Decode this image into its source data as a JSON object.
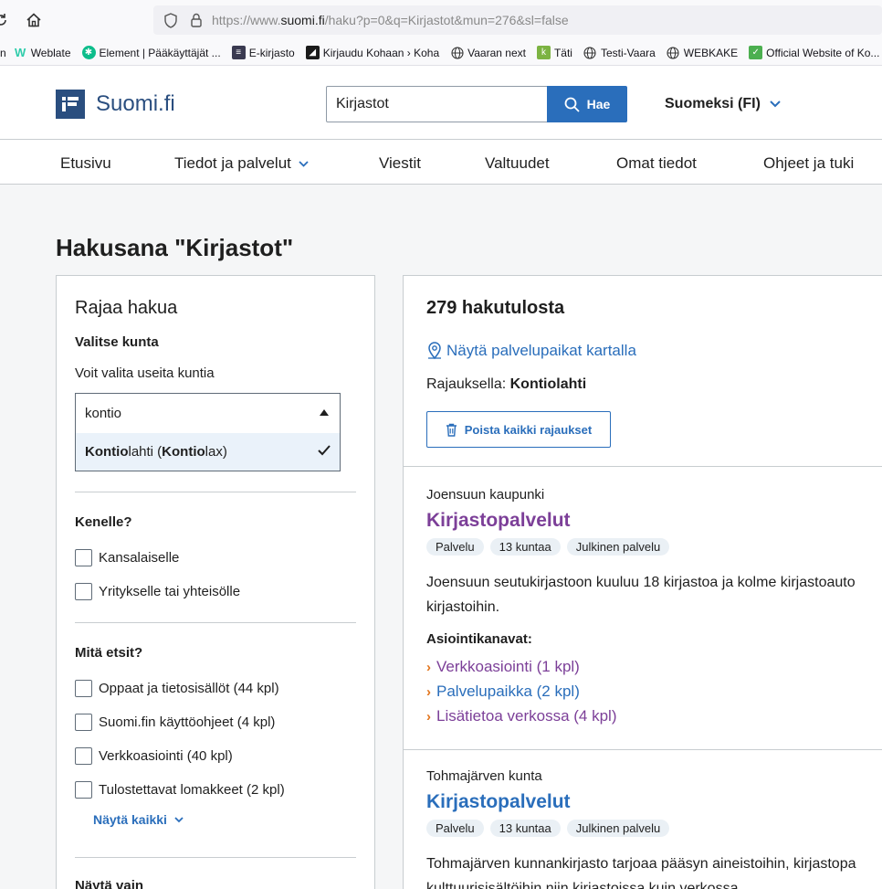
{
  "browser": {
    "url_prefix": "https://www.",
    "url_domain": "suomi.fi",
    "url_rest": "/haku?p=0&q=Kirjastot&mun=276&sl=false",
    "bookmarks": [
      {
        "label": "Weblate",
        "icon": "weblate-icon",
        "color": "#2eccaa"
      },
      {
        "label": "Element | Pääkäyttäjät ...",
        "icon": "element-icon",
        "color": "#0dbd8b"
      },
      {
        "label": "E-kirjasto",
        "icon": "ekirjasto-icon",
        "color": "#3a3a50"
      },
      {
        "label": "Kirjaudu Kohaan › Koha",
        "icon": "koha-icon",
        "color": "#1a1a1a"
      },
      {
        "label": "Vaaran next",
        "icon": "globe-icon",
        "color": ""
      },
      {
        "label": "Täti",
        "icon": "tati-icon",
        "color": "#7cb342"
      },
      {
        "label": "Testi-Vaara",
        "icon": "globe-icon",
        "color": ""
      },
      {
        "label": "WEBKAKE",
        "icon": "globe-icon",
        "color": ""
      },
      {
        "label": "Official Website of Ko...",
        "icon": "koha-leaf-icon",
        "color": "#4caf50"
      }
    ],
    "bookmark_partial": "n"
  },
  "header": {
    "logo_text": "Suomi.fi",
    "search_value": "Kirjastot",
    "search_button": "Hae",
    "language": "Suomeksi (FI)"
  },
  "nav": {
    "items": [
      "Etusivu",
      "Tiedot ja palvelut",
      "Viestit",
      "Valtuudet",
      "Omat tiedot",
      "Ohjeet ja tuki"
    ]
  },
  "page": {
    "title": "Hakusana \"Kirjastot\""
  },
  "filters": {
    "heading": "Rajaa hakua",
    "municipality_label": "Valitse kunta",
    "municipality_hint": "Voit valita useita kuntia",
    "municipality_input": "kontio",
    "option_match1": "Kontio",
    "option_rest1": "lahti (",
    "option_match2": "Kontio",
    "option_rest2": "lax)",
    "for_whom_label": "Kenelle?",
    "for_whom": [
      "Kansalaiselle",
      "Yritykselle tai yhteisölle"
    ],
    "what_label": "Mitä etsit?",
    "what": [
      "Oppaat ja tietosisällöt (44 kpl)",
      "Suomi.fin käyttöohjeet (4 kpl)",
      "Verkkoasiointi (40 kpl)",
      "Tulostettavat lomakkeet (2 kpl)"
    ],
    "show_all": "Näytä kaikki",
    "show_only_label": "Näytä vain"
  },
  "results": {
    "count": "279 hakutulosta",
    "map_link": "Näytä palvelupaikat kartalla",
    "filter_prefix": "Rajauksella: ",
    "filter_value": "Kontiolahti",
    "clear_button": "Poista kaikki rajaukset",
    "items": [
      {
        "org": "Joensuun kaupunki",
        "title": "Kirjastopalvelut",
        "tags": [
          "Palvelu",
          "13 kuntaa",
          "Julkinen palvelu"
        ],
        "desc1": "Joensuun seutukirjastoon kuuluu 18 kirjastoa ja kolme kirjastoauto",
        "desc2": "kirjastoihin.",
        "channels_label": "Asiointikanavat:",
        "channels": [
          "Verkkoasiointi (1 kpl)",
          "Palvelupaikka (2 kpl)",
          "Lisätietoa verkossa (4 kpl)"
        ]
      },
      {
        "org": "Tohmajärven kunta",
        "title": "Kirjastopalvelut",
        "tags": [
          "Palvelu",
          "13 kuntaa",
          "Julkinen palvelu"
        ],
        "desc1": "Tohmajärven kunnankirjasto tarjoaa pääsyn aineistoihin, kirjastopa",
        "desc2": "kulttuurisisältöihin niin kirjastoissa kuin verkossa."
      }
    ]
  }
}
